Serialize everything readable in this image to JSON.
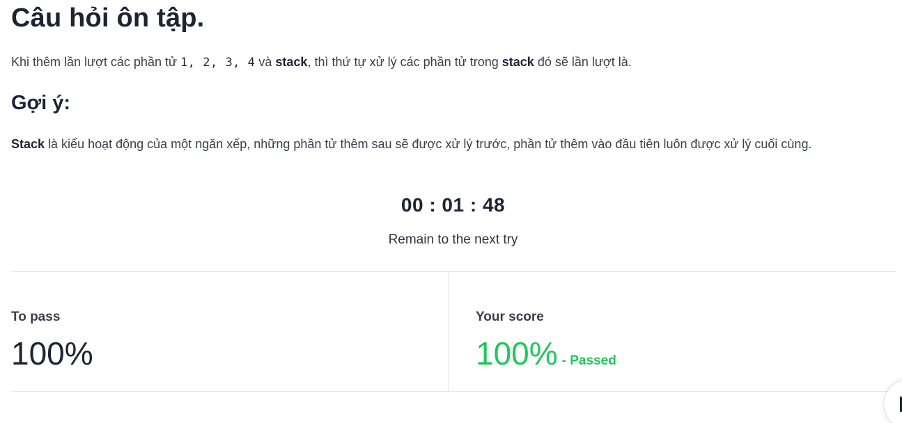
{
  "quiz": {
    "title": "Câu hỏi ôn tập.",
    "question": {
      "prefix": "Khi thêm lần lượt các phần tử ",
      "sequence": "1, 2, 3, 4",
      "middle1": " và ",
      "bold1": "stack",
      "middle2": ", thì thứ tự xử lý các phần tử trong ",
      "bold2": "stack",
      "suffix": " đó sẽ lần lượt là."
    },
    "hint": {
      "title": "Gợi ý:",
      "bold": "Stack",
      "text": " là kiểu hoạt động của một ngăn xếp, những phần tử thêm sau sẽ được xử lý trước, phần tử thêm vào đầu tiên luôn được xử lý cuối cùng."
    }
  },
  "timer": {
    "value": "00 : 01 : 48",
    "caption": "Remain to the next try"
  },
  "results": {
    "to_pass_label": "To pass",
    "to_pass_value": "100%",
    "score_label": "Your score",
    "score_value": "100%",
    "status_text": "- Passed"
  },
  "colors": {
    "pass": "#22c55e",
    "text": "#1c2434",
    "divider": "#e3e5ea"
  },
  "icons": {
    "floating_button": "chat-icon"
  }
}
